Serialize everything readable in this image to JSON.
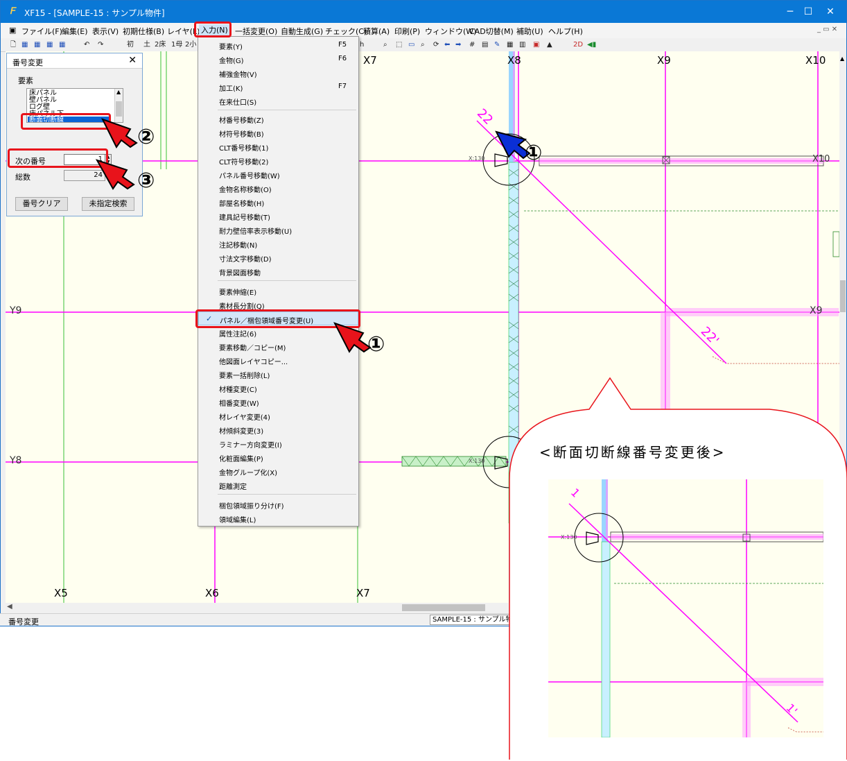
{
  "window": {
    "title": "XF15 - [SAMPLE-15 : サンプル物件]",
    "app_icon": "xf-app-icon",
    "controls": {
      "minimize": "─",
      "maximize": "☐",
      "close": "✕"
    }
  },
  "menubar": {
    "items": [
      "ファイル(F)",
      "編集(E)",
      "表示(V)",
      "初期仕様(B)",
      "レイヤ(L)",
      "入力(N)",
      "一括変更(O)",
      "自動生成(G)",
      "チェック(C)",
      "積算(A)",
      "印刷(P)",
      "ウィンドウ(W)",
      "CAD切替(M)",
      "補助(U)",
      "ヘルプ(H)"
    ],
    "active_index": 5,
    "mdi_controls": "_ ▭ ✕"
  },
  "toolbar": {
    "left_buttons": [
      "初",
      "土",
      "2床",
      "1母",
      "2小"
    ],
    "right_label_2d": "2D"
  },
  "dialog": {
    "title": "番号変更",
    "close": "✕",
    "group_label": "要素",
    "list_items": [
      "床パネル",
      "壁パネル",
      "ログ壁",
      "床パネル下",
      "断面切断線"
    ],
    "selected_item": "断面切断線",
    "next_number_label": "次の番号",
    "next_number_value": "1",
    "total_label": "総数",
    "total_value": "24",
    "clear_button": "番号クリア",
    "search_button": "未指定検索"
  },
  "dropdown": {
    "items": [
      {
        "label": "要素(Y)",
        "shortcut": "F5"
      },
      {
        "label": "金物(G)",
        "shortcut": "F6"
      },
      {
        "label": "補強金物(V)",
        "shortcut": ""
      },
      {
        "label": "加工(K)",
        "shortcut": "F7"
      },
      {
        "label": "在来仕口(S)",
        "shortcut": ""
      },
      {
        "label": "材番号移動(Z)",
        "shortcut": ""
      },
      {
        "label": "材符号移動(B)",
        "shortcut": ""
      },
      {
        "label": "CLT番号移動(1)",
        "shortcut": ""
      },
      {
        "label": "CLT符号移動(2)",
        "shortcut": ""
      },
      {
        "label": "パネル番号移動(W)",
        "shortcut": ""
      },
      {
        "label": "金物名称移動(O)",
        "shortcut": ""
      },
      {
        "label": "部屋名移動(H)",
        "shortcut": ""
      },
      {
        "label": "建具記号移動(T)",
        "shortcut": ""
      },
      {
        "label": "耐力壁倍率表示移動(U)",
        "shortcut": ""
      },
      {
        "label": "注記移動(N)",
        "shortcut": ""
      },
      {
        "label": "寸法文字移動(D)",
        "shortcut": ""
      },
      {
        "label": "背景図面移動",
        "shortcut": ""
      },
      {
        "label": "要素伸縮(E)",
        "shortcut": ""
      },
      {
        "label": "素材長分割(Q)",
        "shortcut": ""
      },
      {
        "label": "パネル／梱包領域番号変更(U)",
        "shortcut": "",
        "checked": true
      },
      {
        "label": "属性注記(6)",
        "shortcut": ""
      },
      {
        "label": "要素移動／コピー(M)",
        "shortcut": ""
      },
      {
        "label": "他図面レイヤコピー...",
        "shortcut": ""
      },
      {
        "label": "要素一括削除(L)",
        "shortcut": ""
      },
      {
        "label": "材種変更(C)",
        "shortcut": ""
      },
      {
        "label": "相番変更(W)",
        "shortcut": ""
      },
      {
        "label": "材レイヤ変更(4)",
        "shortcut": ""
      },
      {
        "label": "材傾斜変更(3)",
        "shortcut": ""
      },
      {
        "label": "ラミナー方向変更(I)",
        "shortcut": ""
      },
      {
        "label": "化粧面編集(P)",
        "shortcut": ""
      },
      {
        "label": "金物グループ化(X)",
        "shortcut": ""
      },
      {
        "label": "距離測定",
        "shortcut": ""
      },
      {
        "label": "梱包領域振り分け(F)",
        "shortcut": ""
      },
      {
        "label": "領域編集(L)",
        "shortcut": ""
      }
    ],
    "check_mark": "✓"
  },
  "canvas": {
    "grid_labels_top": [
      "X7",
      "X8",
      "X9",
      "X10"
    ],
    "grid_labels_bottom": [
      "X5",
      "X6",
      "X7"
    ],
    "grid_labels_left": [
      "Y9",
      "Y8"
    ],
    "right_labels": [
      "X9",
      "X10"
    ],
    "section_label_top": "22",
    "section_label_mid": "22'",
    "small_tag": "X:130"
  },
  "statusbar": {
    "left": "番号変更",
    "right": "SAMPLE-15 : サンプル物件"
  },
  "annotations": {
    "marker_1": "①",
    "marker_2": "②",
    "marker_3": "③",
    "callout_title": "<断面切断線番号変更後>",
    "inset_label_top": "1",
    "inset_label_bottom": "1'",
    "inset_tag": "X:130"
  },
  "colors": {
    "title_bar": "#0a78d6",
    "highlight_red": "#e8131b",
    "grid_magenta": "#ff00ff",
    "grid_green": "#38c038",
    "canvas_bg": "#fffff0",
    "selection_blue": "#0a64d6"
  }
}
